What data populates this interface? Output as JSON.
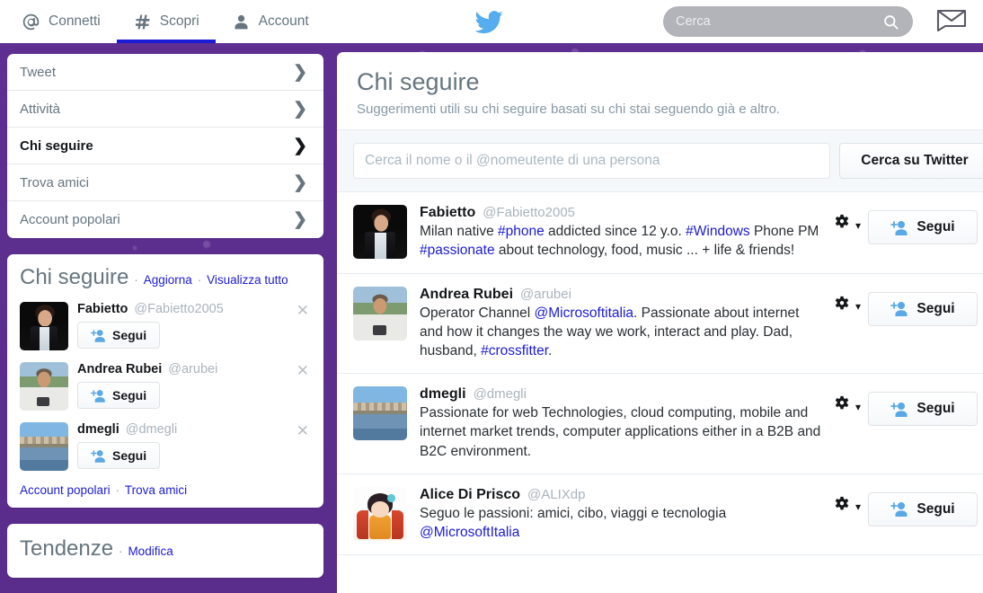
{
  "topnav": {
    "items": [
      {
        "label": "Connetti",
        "icon": "at-icon",
        "active": false
      },
      {
        "label": "Scopri",
        "icon": "hash-icon",
        "active": true
      },
      {
        "label": "Account",
        "icon": "person-icon",
        "active": false
      }
    ],
    "logo_icon": "twitter-bird-icon",
    "search": {
      "placeholder": "Cerca",
      "value": "",
      "icon": "search-icon"
    },
    "messages_icon": "envelope-icon",
    "accent_blue": "#1b1bd6",
    "brand_blue": "#55acee"
  },
  "sidebar": {
    "menu": [
      {
        "label": "Tweet",
        "selected": false
      },
      {
        "label": "Attività",
        "selected": false
      },
      {
        "label": "Chi seguire",
        "selected": true
      },
      {
        "label": "Trova amici",
        "selected": false
      },
      {
        "label": "Account popolari",
        "selected": false
      }
    ],
    "who_to_follow": {
      "title": "Chi seguire",
      "refresh_label": "Aggiorna",
      "view_all_label": "Visualizza tutto",
      "separator": "·",
      "follow_label": "Segui",
      "dismiss_icon": "close-icon",
      "follow_icon": "add-person-icon",
      "people": [
        {
          "name": "Fabietto",
          "handle": "@Fabietto2005",
          "avatar": "av-fab"
        },
        {
          "name": "Andrea Rubei",
          "handle": "@arubei",
          "avatar": "av-and"
        },
        {
          "name": "dmegli",
          "handle": "@dmegli",
          "avatar": "av-dme"
        }
      ],
      "footer_links": [
        "Account popolari",
        "Trova amici"
      ]
    },
    "trends": {
      "title": "Tendenze",
      "separator": "·",
      "edit_label": "Modifica"
    }
  },
  "main": {
    "title": "Chi seguire",
    "subtitle": "Suggerimenti utili su chi seguire basati su chi stai seguendo già e altro.",
    "person_search": {
      "placeholder": "Cerca il nome o il @nomeutente di una persona",
      "value": "",
      "button_label": "Cerca su Twitter"
    },
    "follow_label": "Segui",
    "gear_icon": "gear-icon",
    "caret_icon": "chevron-down-icon",
    "follow_icon": "add-person-icon",
    "suggestions": [
      {
        "name": "Fabietto",
        "handle": "@Fabietto2005",
        "avatar": "av-fab",
        "bio_parts": [
          {
            "t": "Milan native ",
            "link": false
          },
          {
            "t": "#phone",
            "link": true
          },
          {
            "t": " addicted since 12 y.o. ",
            "link": false
          },
          {
            "t": "#Windows",
            "link": true
          },
          {
            "t": " Phone PM ",
            "link": false
          },
          {
            "t": "#passionate",
            "link": true
          },
          {
            "t": " about technology, food, music ... + life & friends!",
            "link": false
          }
        ]
      },
      {
        "name": "Andrea Rubei",
        "handle": "@arubei",
        "avatar": "av-and",
        "bio_parts": [
          {
            "t": "Operator Channel ",
            "link": false
          },
          {
            "t": "@Microsoftitalia",
            "link": true
          },
          {
            "t": ". Passionate about internet and how it changes the way we work, interact and play. Dad, husband, ",
            "link": false
          },
          {
            "t": "#crossfitter",
            "link": true
          },
          {
            "t": ".",
            "link": false
          }
        ]
      },
      {
        "name": "dmegli",
        "handle": "@dmegli",
        "avatar": "av-dme",
        "bio_parts": [
          {
            "t": "Passionate for web Technologies, cloud computing, mobile and internet market trends, computer applications either in a B2B and B2C environment.",
            "link": false
          }
        ]
      },
      {
        "name": "Alice Di Prisco",
        "handle": "@ALIXdp",
        "avatar": "av-ali",
        "bio_parts": [
          {
            "t": "Seguo le passioni: amici, cibo, viaggi e tecnologia ",
            "link": false
          },
          {
            "t": "@MicrosoftItalia",
            "link": true
          }
        ]
      }
    ]
  }
}
